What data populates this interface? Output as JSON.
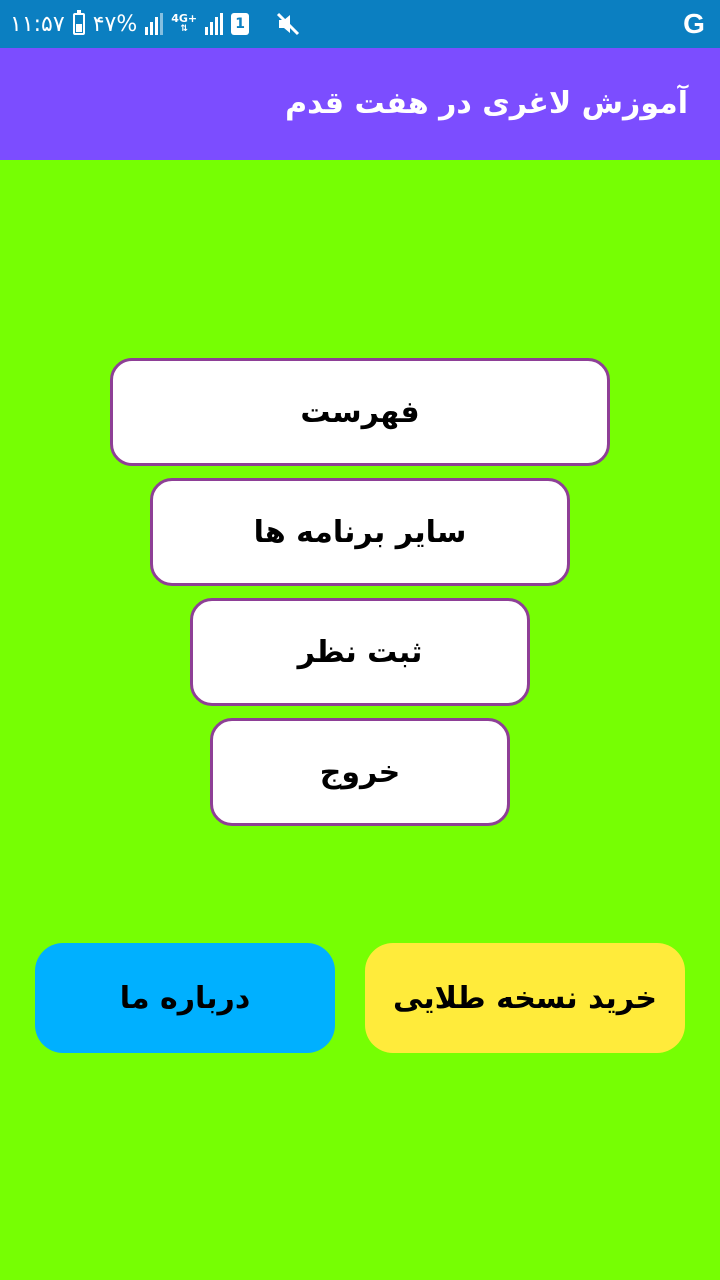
{
  "status_bar": {
    "time": "۱۱:۵۷",
    "battery": "۴۷%",
    "battery_level": 0.47,
    "network": "4G+",
    "sim_slot": "1",
    "google_icon": "google-g-icon"
  },
  "app_bar": {
    "title": "آموزش لاغری در هفت قدم"
  },
  "menu": {
    "fehrest": "فهرست",
    "other_apps": "سایر برنامه ها",
    "submit_review": "ثبت نظر",
    "exit": "خروج"
  },
  "bottom": {
    "about": "درباره ما",
    "buy_gold": "خرید نسخه طلایی"
  },
  "colors": {
    "status_bar": "#0b7fc1",
    "app_bar": "#7c4dff",
    "background": "#76ff03",
    "button_border": "#8e3f96",
    "about_button": "#00b0ff",
    "gold_button": "#ffeb3b"
  }
}
